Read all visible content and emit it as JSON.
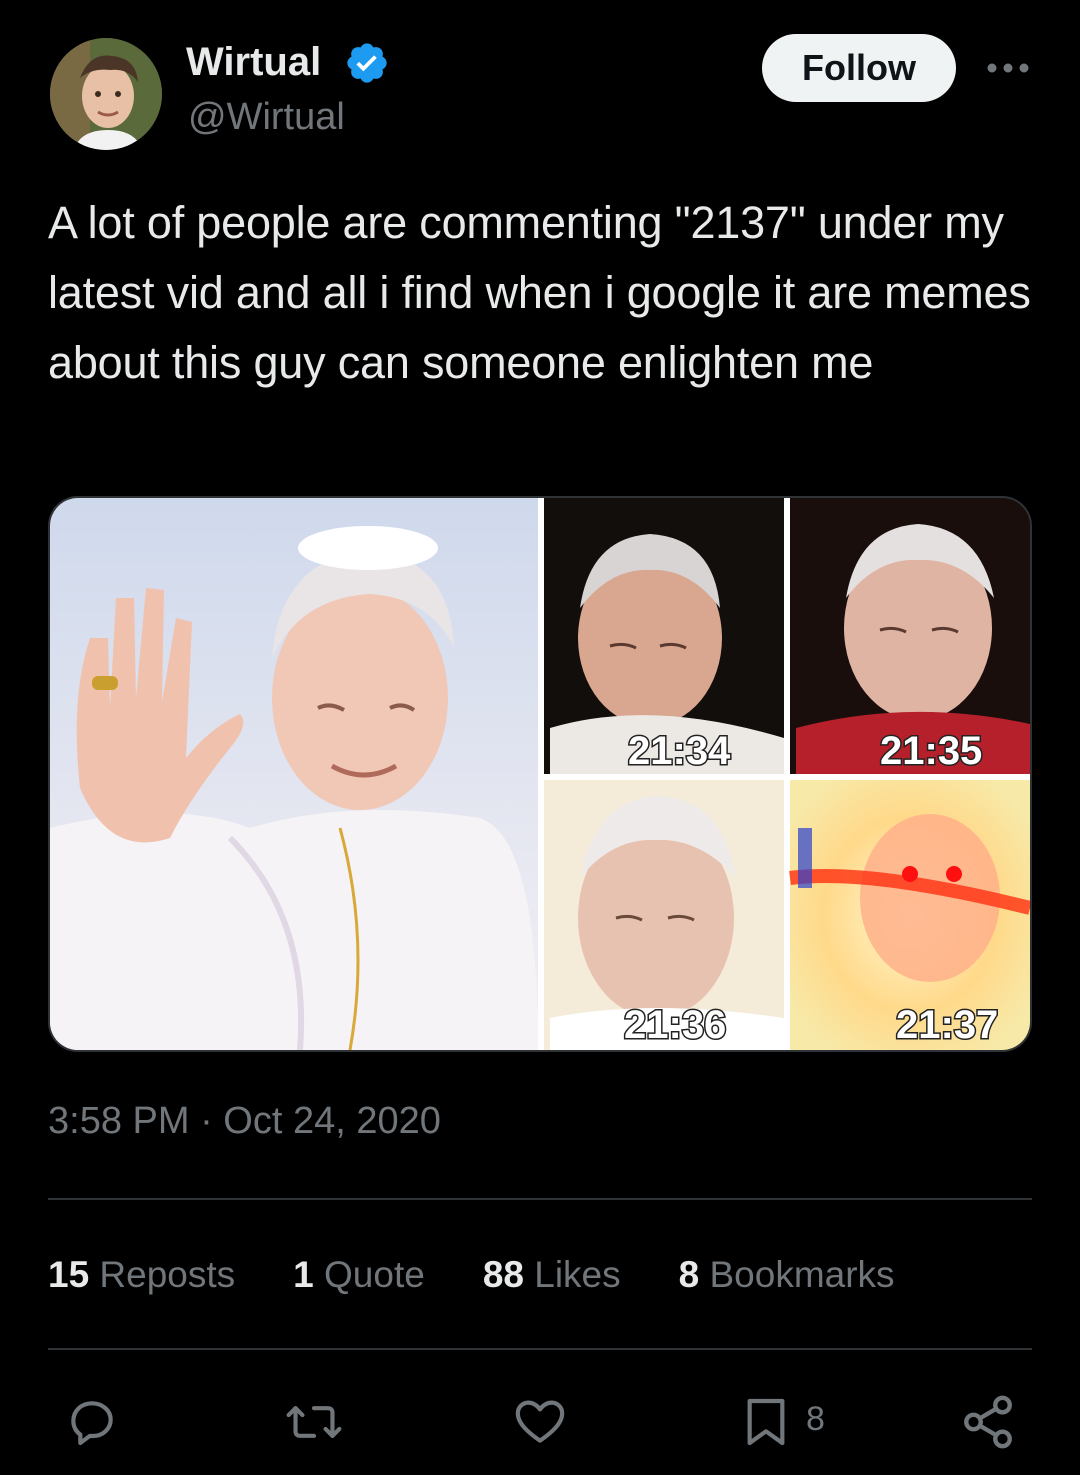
{
  "author": {
    "display_name": "Wirtual",
    "handle": "@Wirtual",
    "verified": true,
    "verified_color": "#1d9bf0"
  },
  "header": {
    "follow_label": "Follow",
    "more_icon": "more-dots-icon"
  },
  "tweet": {
    "text": "A lot of people are commenting \"2137\" under my latest vid and all i find when i google it are memes about this guy can someone enlighten me",
    "timestamp": "3:58 PM · Oct 24, 2020"
  },
  "media": {
    "panel_labels": [
      "21:34",
      "21:35",
      "21:36",
      "21:37"
    ]
  },
  "stats": [
    {
      "count": "15",
      "label": " Reposts"
    },
    {
      "count": "1",
      "label": " Quote"
    },
    {
      "count": "88",
      "label": " Likes"
    },
    {
      "count": "8",
      "label": " Bookmarks"
    }
  ],
  "actions": {
    "reply_icon": "reply-icon",
    "repost_icon": "repost-icon",
    "like_icon": "heart-icon",
    "bookmark_icon": "bookmark-icon",
    "bookmark_count": "8",
    "share_icon": "share-icon"
  },
  "colors": {
    "background": "#000000",
    "text_primary": "#e7e9ea",
    "text_secondary": "#71767b",
    "divider": "#2f3336",
    "follow_bg": "#eff3f4"
  }
}
